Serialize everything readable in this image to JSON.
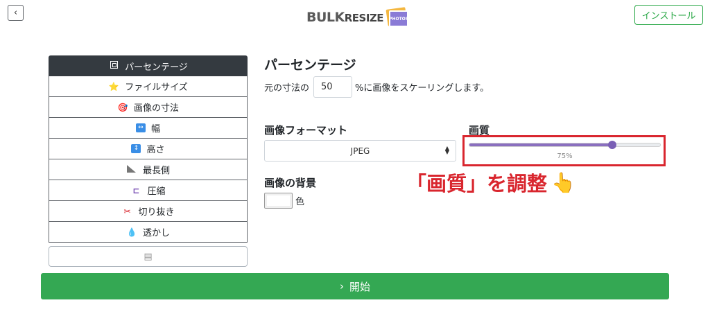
{
  "header": {
    "back_glyph": "‹",
    "logo_word1": "BULK",
    "logo_word2": "RESIZE",
    "logo_badge": "PHOTOS",
    "install_label": "インストール"
  },
  "sidebar": {
    "items": [
      {
        "label": "パーセンテージ",
        "icon": "percentage-icon",
        "active": true
      },
      {
        "label": "ファイルサイズ",
        "icon": "star-icon",
        "glyph": "⭐"
      },
      {
        "label": "画像の寸法",
        "icon": "target-icon",
        "glyph": "🎯"
      },
      {
        "label": "幅",
        "icon": "horizontal-arrows-icon",
        "glyph": "↔"
      },
      {
        "label": "高さ",
        "icon": "vertical-arrows-icon",
        "glyph": "↕"
      },
      {
        "label": "最長側",
        "icon": "triangle-ruler-icon"
      },
      {
        "label": "圧縮",
        "icon": "clamp-icon",
        "glyph": "⊏"
      },
      {
        "label": "切り抜き",
        "icon": "scissors-icon",
        "glyph": "✂"
      },
      {
        "label": "透かし",
        "icon": "droplet-icon",
        "glyph": "💧"
      }
    ],
    "more_glyph": "▤"
  },
  "main": {
    "title": "パーセンテージ",
    "scale_prefix": "元の寸法の",
    "scale_value": "50",
    "scale_suffix": "%に画像をスケーリングします。",
    "format_label": "画像フォーマット",
    "format_value": "JPEG",
    "background_label": "画像の背景",
    "background_color_label": "色",
    "quality_label": "画質",
    "quality_percent": 75,
    "quality_value_text": "75%"
  },
  "annotation": {
    "text": "「画質」を調整",
    "hand_glyph": "👆"
  },
  "footer": {
    "start_glyph": "›",
    "start_label": "開始"
  },
  "colors": {
    "accent_green": "#34a853",
    "active_dark": "#343a40",
    "slider_purple": "#8a6fbf",
    "annotation_red": "#d9262e"
  }
}
